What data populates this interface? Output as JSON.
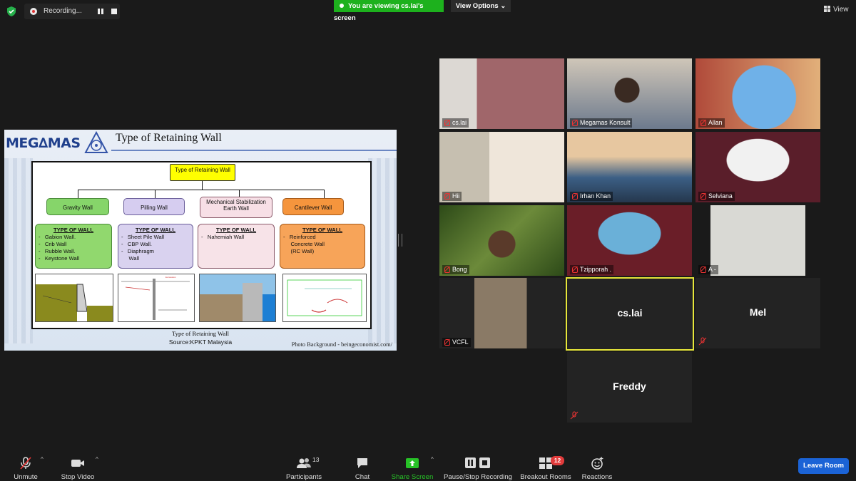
{
  "top_bar": {
    "recording_label": "Recording...",
    "viewing_banner": "You are viewing cs.lai's screen",
    "view_options": "View Options ⌄",
    "view_label": "View"
  },
  "slide": {
    "logo_text": "MEG∆MAS",
    "title": "Type of Retaining Wall",
    "root": "Type of Retaining Wall",
    "categories": [
      {
        "name": "Gravity Wall",
        "heading": "TYPE OF WALL",
        "items": [
          "-   Gabion Wall.",
          "-   Crib Wall",
          "-   Rubble Wall.",
          "-   Keystone Wall"
        ]
      },
      {
        "name": "Pilling Wall",
        "heading": "TYPE OF WALL",
        "items": [
          "-   Sheet Pile Wall",
          "-   CBP Wall.",
          "-   Diaphragm",
          "     Wall"
        ]
      },
      {
        "name": "Mechanical Stabilization Earth Wall",
        "heading": "TYPE OF WALL",
        "items": [
          "-   Nahemiah Wall"
        ]
      },
      {
        "name": "Cantilever Wall",
        "heading": "TYPE OF WALL",
        "items": [
          "-   Reinforced",
          "     Concrete Wall",
          "     (RC Wall)"
        ]
      }
    ],
    "caption_title": "Type of Retaining Wall",
    "caption_source": "Source:KPKT Malaysia",
    "photo_credit": "Photo Background - beingeconomist.com/"
  },
  "participants_tiles": [
    {
      "name": "cs.lai",
      "bg": "#8a6a62"
    },
    {
      "name": "Megamas Konsult",
      "bg": "#b6a690"
    },
    {
      "name": "Allan",
      "bg": "#6aa0d6"
    },
    {
      "name": "Hii",
      "bg": "#d9d2c4"
    },
    {
      "name": "Irhan Khan",
      "bg": "#6b7a8c"
    },
    {
      "name": "Selviana",
      "bg": "#5a2a34"
    },
    {
      "name": "Bong",
      "bg": "#3d5a22"
    },
    {
      "name": "Tzipporah .",
      "bg": "#7a2630"
    },
    {
      "name": "A -",
      "bg": "#2a2a2a"
    },
    {
      "name": "VCFL",
      "bg": "#2a2a2a"
    },
    {
      "name": "cs.lai",
      "bg": "#232323"
    },
    {
      "name": "Mel",
      "bg": "#232323"
    },
    {
      "name": "Freddy",
      "bg": "#232323"
    }
  ],
  "toolbar": {
    "unmute": "Unmute",
    "stop_video": "Stop Video",
    "participants": "Participants",
    "participant_count": "13",
    "chat": "Chat",
    "share_screen": "Share Screen",
    "pause_stop_recording": "Pause/Stop Recording",
    "breakout_rooms": "Breakout Rooms",
    "breakout_badge": "12",
    "reactions": "Reactions",
    "leave_room": "Leave Room"
  },
  "colors": {
    "share_green": "#27c227",
    "banner_green": "#1db11d",
    "leave_blue": "#1b63d6",
    "active_speaker": "#e6e63a"
  }
}
